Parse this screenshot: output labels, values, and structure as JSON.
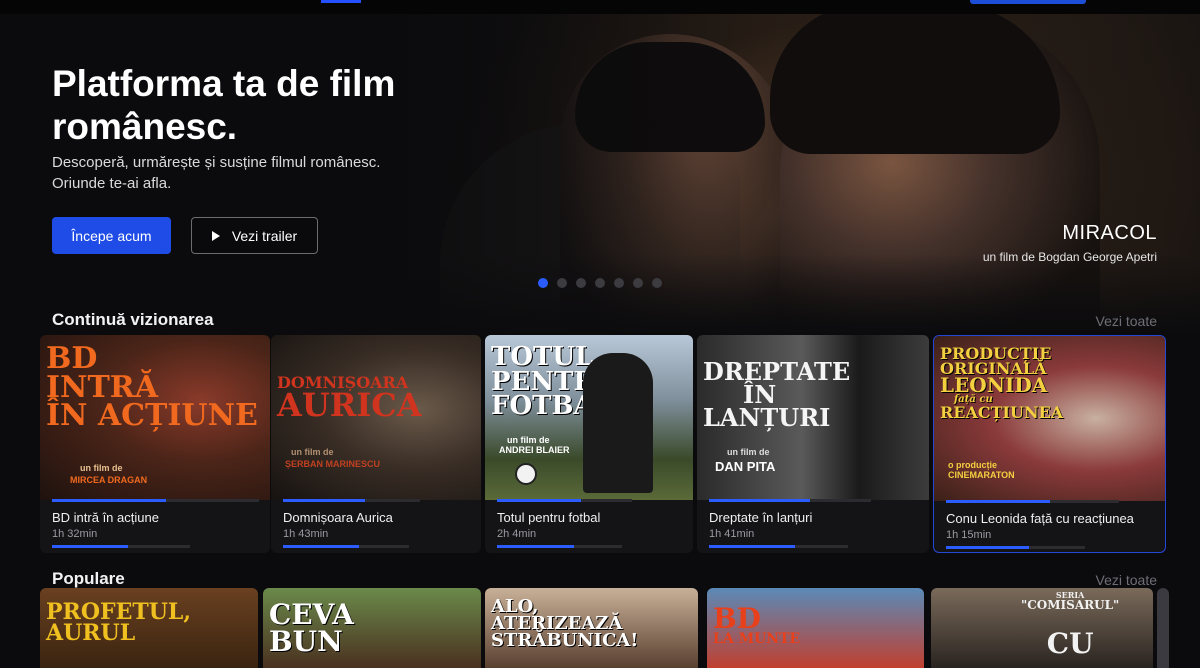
{
  "hero": {
    "title": "Platforma ta de film românesc.",
    "subtitle": "Descoperă, urmărește și susține filmul românesc. Oriunde te-ai afla.",
    "primary_button": "Începe acum",
    "secondary_button": "Vezi trailer",
    "featured_film": "MIRACOL",
    "featured_byline": "un film de Bogdan George Apetri",
    "slide_count": 7,
    "active_slide": 1
  },
  "continue_watching": {
    "title": "Continuă vizionarea",
    "see_all": "Vezi toate",
    "items": [
      {
        "title": "BD intră în acțiune",
        "duration": "1h 32min",
        "progress": 0.55,
        "poster_lines": [
          "BD",
          "INTRĂ",
          "ÎN ACȚIUNE"
        ],
        "poster_credit": "un film de",
        "poster_director": "MIRCEA DRAGAN"
      },
      {
        "title": "Domnișoara Aurica",
        "duration": "1h 43min",
        "progress": 0.6,
        "poster_lines": [
          "DOMNIȘOARA",
          "AURICA"
        ],
        "poster_credit": "un film de",
        "poster_director": "ȘERBAN MARINESCU"
      },
      {
        "title": "Totul pentru fotbal",
        "duration": "2h 4min",
        "progress": 0.62,
        "poster_lines": [
          "TOTUL",
          "PENTRU",
          "FOTBAL"
        ],
        "poster_credit": "un film de",
        "poster_director": "ANDREI BLAIER"
      },
      {
        "title": "Dreptate în lanțuri",
        "duration": "1h 41min",
        "progress": 0.62,
        "poster_lines": [
          "DREPTATE",
          "ÎN",
          "LANȚURI"
        ],
        "poster_credit": "un film de",
        "poster_director": "DAN PITA"
      },
      {
        "title": "Conu Leonida față cu reacțiunea",
        "duration": "1h 15min",
        "progress": 0.6,
        "poster_lines": [
          "PRODUCȚIE",
          "ORIGINALĂ",
          "LEONIDA",
          "față cu",
          "REACȚIUNEA"
        ],
        "poster_credit": "o producție",
        "poster_director": "CINEMARATON"
      }
    ]
  },
  "popular": {
    "title": "Populare",
    "see_all": "Vezi toate",
    "items": [
      {
        "poster_lines": [
          "PROFETUL,",
          "AURUL"
        ]
      },
      {
        "poster_lines": [
          "CEVA",
          "BUN"
        ]
      },
      {
        "poster_lines": [
          "ALO,",
          "ATERIZEAZĂ",
          "STRĂBUNICA!"
        ]
      },
      {
        "poster_lines": [
          "BD",
          "LA MUNTE"
        ]
      },
      {
        "poster_lines": [
          "SERIA",
          "\"COMISARUL\"",
          "CU"
        ]
      }
    ]
  },
  "colors": {
    "accent": "#1f4ce6",
    "background": "#0b0b0d",
    "muted_text": "#6e6e76"
  }
}
